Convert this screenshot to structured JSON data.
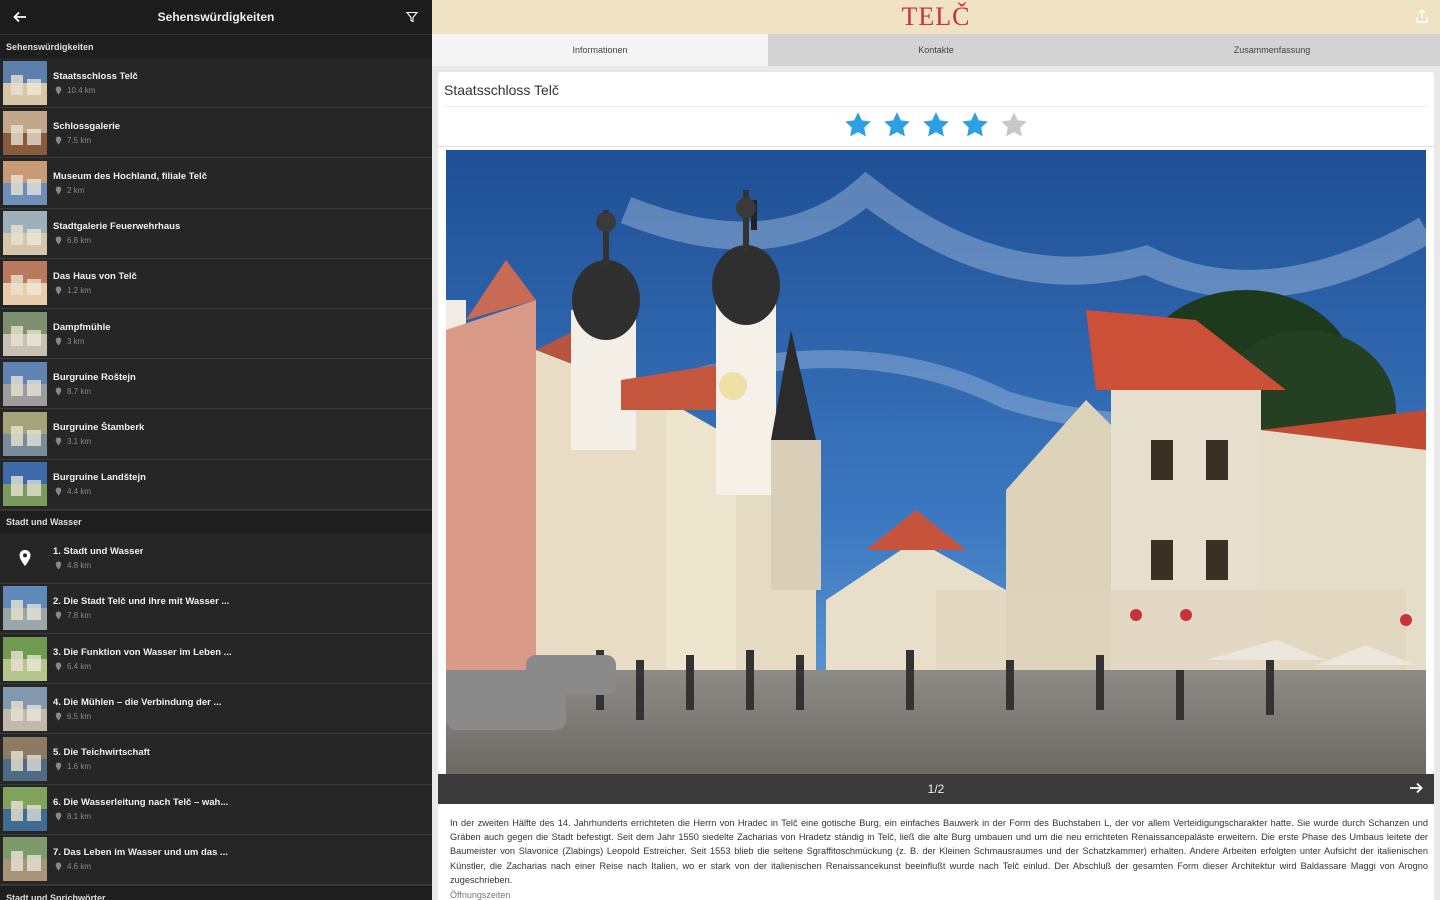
{
  "left": {
    "title": "Sehenswürdigkeiten",
    "sections": [
      {
        "header": "Sehenswürdigkeiten",
        "items": [
          {
            "name": "Staatsschloss Telč",
            "distance": "10.4 km",
            "thumb": "castle"
          },
          {
            "name": "Schlossgalerie",
            "distance": "7.5 km",
            "thumb": "gallery"
          },
          {
            "name": "Museum des Hochland, filiale Telč",
            "distance": "2 km",
            "thumb": "museum"
          },
          {
            "name": "Stadtgalerie Feuerwehrhaus",
            "distance": "6.8 km",
            "thumb": "town"
          },
          {
            "name": "Das Haus von Telč",
            "distance": "1.2 km",
            "thumb": "house"
          },
          {
            "name": "Dampfmühle",
            "distance": "3 km",
            "thumb": "mill"
          },
          {
            "name": "Burgruine Roštejn",
            "distance": "8.7 km",
            "thumb": "rostejn"
          },
          {
            "name": "Burgruine Štamberk",
            "distance": "3.1 km",
            "thumb": "ruin"
          },
          {
            "name": "Burgruine Landštejn",
            "distance": "4.4 km",
            "thumb": "landstejn"
          }
        ]
      },
      {
        "header": "Stadt und Wasser",
        "items": [
          {
            "name": "1. Stadt und Wasser",
            "distance": "4.8 km",
            "thumb": "pin"
          },
          {
            "name": "2. Die Stadt Telč und ihre mit Wasser ...",
            "distance": "7.8 km",
            "thumb": "water"
          },
          {
            "name": "3. Die Funktion von Wasser im Leben ...",
            "distance": "6.4 km",
            "thumb": "green"
          },
          {
            "name": "4. Die Mühlen – die Verbindung der ...",
            "distance": "6.5 km",
            "thumb": "mills"
          },
          {
            "name": "5. Die Teichwirtschaft",
            "distance": "1.6 km",
            "thumb": "pond"
          },
          {
            "name": "6. Die Wasserleitung nach Telč – wah...",
            "distance": "8.1 km",
            "thumb": "pipe"
          },
          {
            "name": "7. Das Leben im Wasser und um das ...",
            "distance": "4.6 km",
            "thumb": "life"
          }
        ]
      },
      {
        "header": "Stadt und Sprichwörter",
        "items": []
      }
    ]
  },
  "header": {
    "logo": "TELČ"
  },
  "tabs": [
    {
      "label": "Informationen",
      "active": true
    },
    {
      "label": "Kontakte",
      "active": false
    },
    {
      "label": "Zusammenfassung",
      "active": false
    }
  ],
  "detail": {
    "title": "Staatsschloss Telč",
    "rating": 4,
    "max_rating": 5,
    "gallery_counter": "1/2",
    "description": "In der zweiten Hälfte des 14. Jahrhunderts errichteten die Herrn von Hradec in Telč eine gotische Burg, ein einfaches Bauwerk in der Form des Buchstaben L, der vor allem Verteidigungscharakter hatte. Sie wurde durch Schanzen und Gräben auch gegen die Stadt befestigt. Seit dem Jahr 1550 siedelte Zacharias von Hradetz ständig in Telč, ließ die alte Burg umbauen und um die neu errichteten Renaissancepaläste erweitern. Die erste Phase des Umbaus leitete der Baumeister von Slavonice (Zlabings) Leopold Estreicher. Seit 1553 blieb die seltene Sgraffitoschmückung (z. B. der Kleinen Schmausraumes und der Schatzkammer) erhalten. Andere Arbeiten erfolgten unter Aufsicht der italienischen Künstler, die Zacharias nach einer Reise nach Italien, wo er stark von der italienischen Renaissancekunst beeinflußt wurde nach Telč einlud. Der Abschluß der gesamten Form dieser Architektur wird Baldassare Maggi von Arogno zugeschrieben.",
    "next_heading": "Öffnungszeiten"
  },
  "colors": {
    "star_active": "#2d9fe3",
    "star_inactive": "#c8c8c8",
    "logo": "#c8313a",
    "topbar": "#efe3c4"
  }
}
